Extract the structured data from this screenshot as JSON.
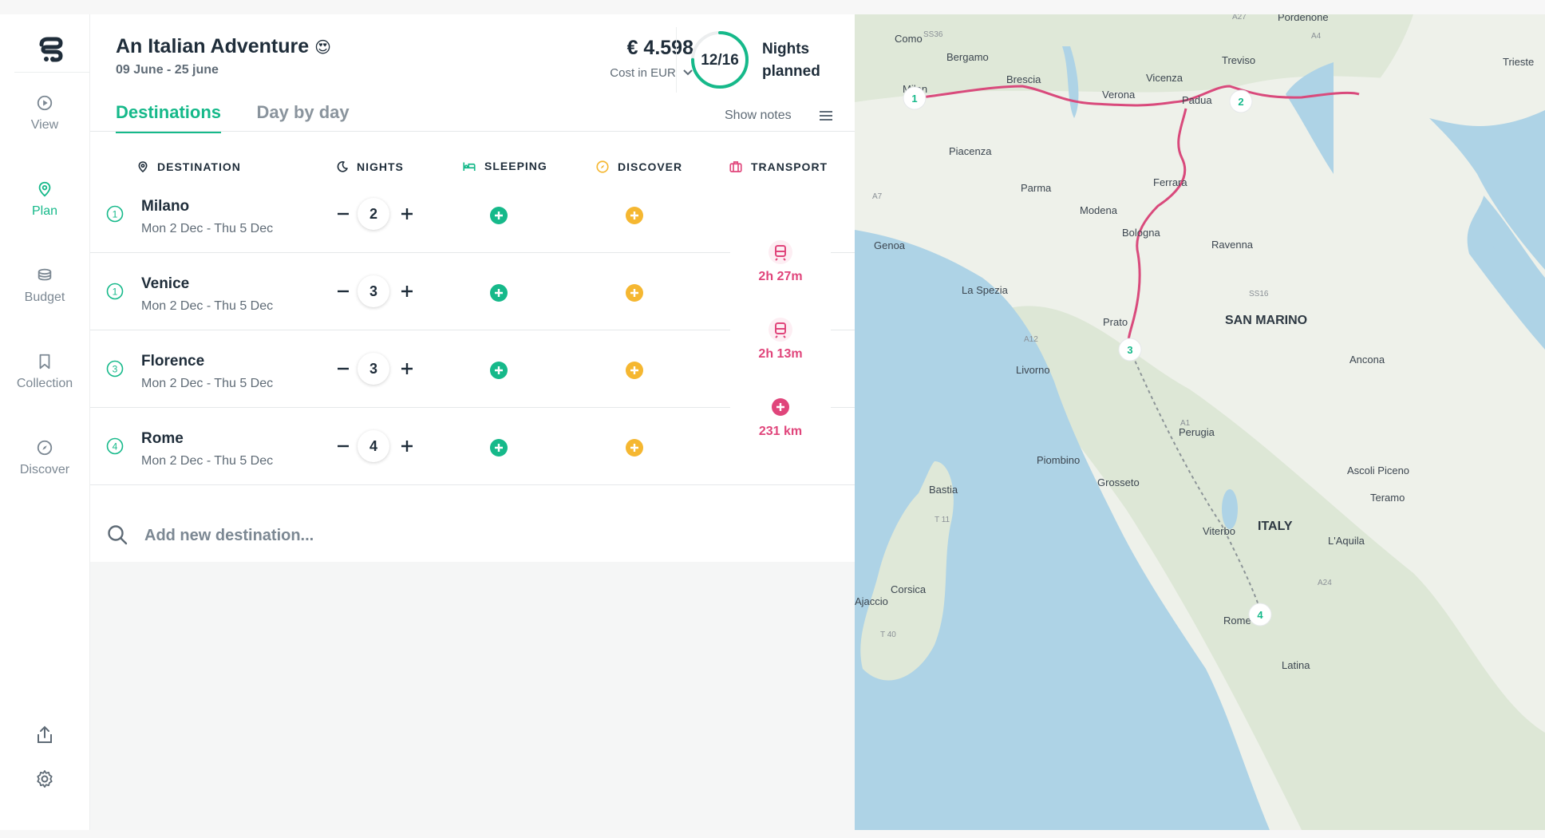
{
  "sidebar": {
    "items": [
      {
        "label": "View",
        "icon": "play-circle-icon"
      },
      {
        "label": "Plan",
        "icon": "map-pin-icon"
      },
      {
        "label": "Budget",
        "icon": "coins-icon"
      },
      {
        "label": "Collection",
        "icon": "bookmark-icon"
      },
      {
        "label": "Discover",
        "icon": "compass-icon"
      }
    ],
    "active": "Plan",
    "bottom_icons": [
      "share-icon",
      "gear-icon"
    ]
  },
  "trip": {
    "title": "An Italian Adventure",
    "emoji": "😍",
    "dates": "09 June - 25 june",
    "cost": "€ 4.598",
    "cost_sub": "Cost in EUR",
    "nights_progress": "12/16",
    "nights_fraction": 0.75,
    "nights_label_1": "Nights",
    "nights_label_2": "planned"
  },
  "tabs": [
    {
      "label": "Destinations",
      "active": true
    },
    {
      "label": "Day by day",
      "active": false
    }
  ],
  "show_notes": "Show notes",
  "columns": {
    "destination": "DESTINATION",
    "nights": "NIGHTS",
    "sleeping": "SLEEPING",
    "discover": "DISCOVER",
    "transport": "TRANSPORT"
  },
  "destinations": [
    {
      "index": "1",
      "name": "Milano",
      "dates": "Mon 2 Dec - Thu 5 Dec",
      "nights": "2"
    },
    {
      "index": "1",
      "name": "Venice",
      "dates": "Mon 2 Dec - Thu 5 Dec",
      "nights": "3"
    },
    {
      "index": "3",
      "name": "Florence",
      "dates": "Mon 2 Dec - Thu 5 Dec",
      "nights": "3"
    },
    {
      "index": "4",
      "name": "Rome",
      "dates": "Mon 2 Dec - Thu 5 Dec",
      "nights": "4"
    }
  ],
  "transport": [
    {
      "icon": "train-icon",
      "label": "2h 27m"
    },
    {
      "icon": "train-icon",
      "label": "2h 13m"
    },
    {
      "icon": "plus-icon",
      "label": "231 km"
    }
  ],
  "search": {
    "placeholder": "Add new destination..."
  },
  "colors": {
    "accent": "#16b98a",
    "discover": "#f5b731",
    "transport": "#e0457b",
    "route": "#d94a7c"
  },
  "map": {
    "cities": [
      "Como",
      "Bergamo",
      "Milan",
      "Brescia",
      "Verona",
      "Vicenza",
      "Padua",
      "Venice",
      "Treviso",
      "Pordenone",
      "Trieste",
      "Piacenza",
      "Parma",
      "Modena",
      "Ferrara",
      "Bologna",
      "Ravenna",
      "Genoa",
      "La Spezia",
      "SAN MARINO",
      "Prato",
      "Livorno",
      "Ancona",
      "Perugia",
      "Piombino",
      "Grosseto",
      "Bastia",
      "Corsica",
      "Ajaccio",
      "Viterbo",
      "ITALY",
      "L'Aquila",
      "Teramo",
      "Ascoli Piceno",
      "Rome",
      "Latina"
    ],
    "roads": [
      "A27",
      "A4",
      "SS36",
      "A7",
      "A12",
      "A1",
      "SS16",
      "A24",
      "T 11",
      "T 40"
    ],
    "markers": [
      "1",
      "2",
      "3",
      "4"
    ]
  }
}
